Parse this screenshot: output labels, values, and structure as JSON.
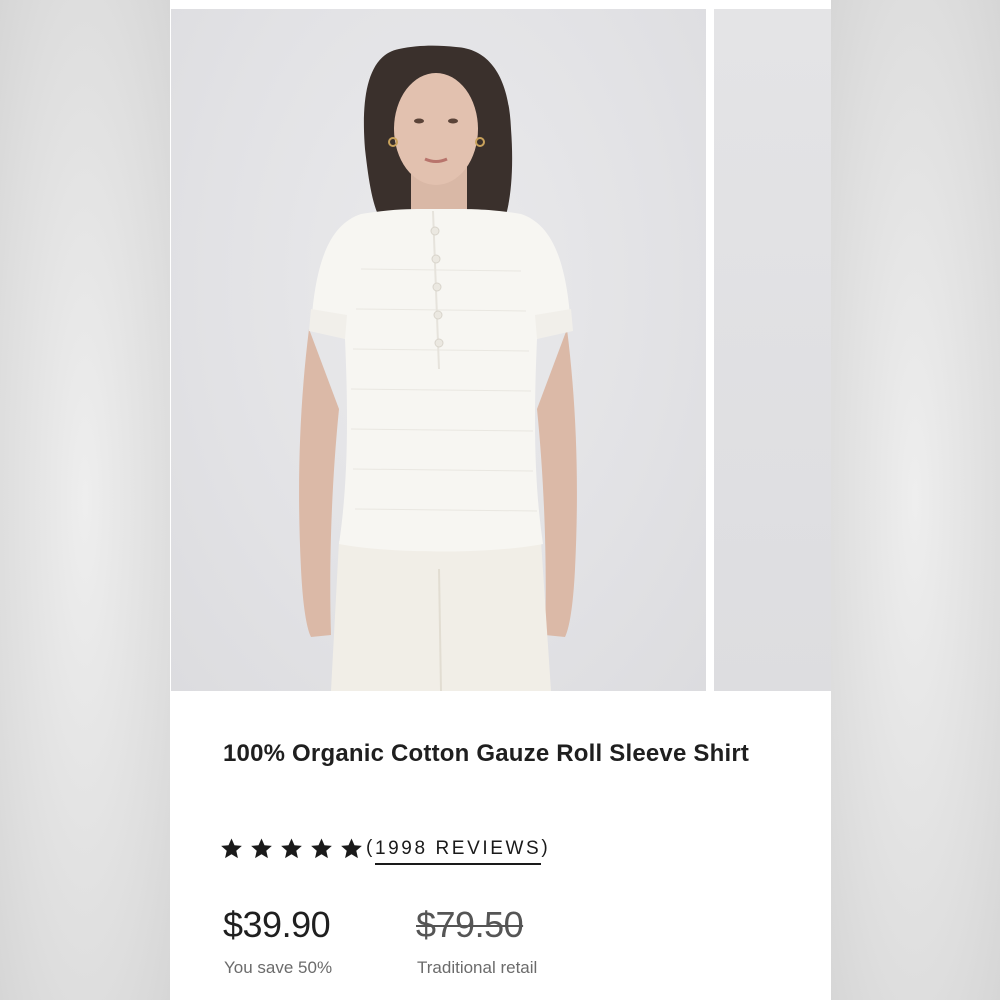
{
  "product": {
    "title": "100% Organic Cotton Gauze Roll Sleeve Shirt",
    "rating": 5,
    "rating_max": 5,
    "reviews_open": "(",
    "reviews_label": "1998 REVIEWS",
    "reviews_close": ")",
    "price": "$39.90",
    "original_price": "$79.50",
    "savings_label": "You save 50%",
    "original_price_label": "Traditional retail"
  },
  "gallery": {
    "images": [
      {
        "description_icon": "product-photo"
      },
      {
        "description_icon": "product-photo"
      }
    ]
  },
  "colors": {
    "text": "#1f1f1f",
    "muted": "#6b6b6b",
    "star": "#1a1a1a"
  }
}
